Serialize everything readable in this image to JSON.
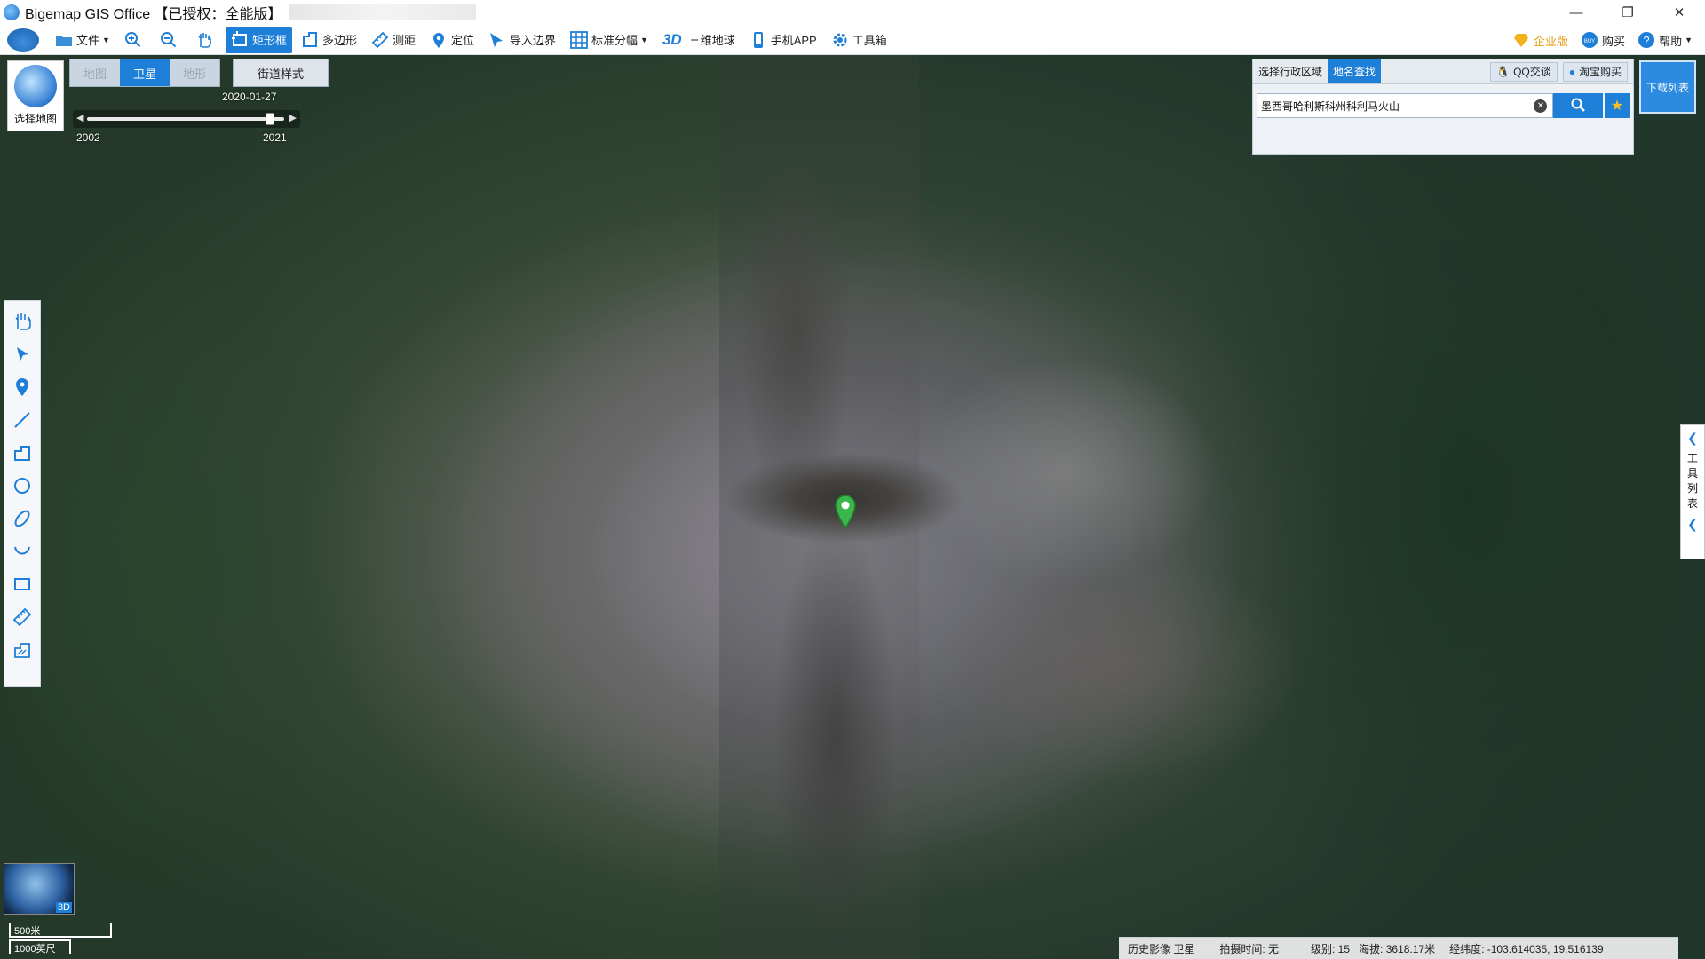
{
  "window": {
    "title": "Bigemap GIS Office 【已授权：全能版】",
    "controls": {
      "minimize": "—",
      "restore": "❐",
      "close": "✕"
    }
  },
  "toolbar": {
    "file": "文件",
    "rect_select": "矩形框",
    "polygon": "多边形",
    "measure": "测距",
    "locate": "定位",
    "import_boundary": "导入边界",
    "standard_sheet": "标准分幅",
    "three_d_label": "3D",
    "globe_3d": "三维地球",
    "mobile_app": "手机APP",
    "toolbox": "工具箱",
    "enterprise": "企业版",
    "buy": "购买",
    "help": "帮助"
  },
  "map_panel": {
    "select_map": "选择地图",
    "tabs": [
      "地图",
      "卫星",
      "地形"
    ],
    "active_tab": "卫星",
    "street_style": "街道样式",
    "timeline": {
      "current": "2020-01-27",
      "start": "2002",
      "end": "2021",
      "position": 0.93
    }
  },
  "search": {
    "tabs": [
      "选择行政区域",
      "地名查找"
    ],
    "active_tab": "地名查找",
    "qq_chat": "QQ交谈",
    "taobao_buy": "淘宝购买",
    "query": "墨西哥哈利斯科州科利马火山"
  },
  "download_list": "下载列表",
  "right_panel": {
    "label": "工具列表"
  },
  "mini_globe": {
    "label": "3D"
  },
  "scale": {
    "metric": "500米",
    "imperial": "1000英尺"
  },
  "status": {
    "history": "历史影像 卫星",
    "capture_time": "拍摄时间: 无",
    "level": "级别:  15",
    "altitude": "海拔: 3618.17米",
    "coordinates": "经纬度:  -103.614035, 19.516139"
  },
  "colors": {
    "accent": "#1e7fd8",
    "marker": "#3cb54a",
    "forest": "#1f3324",
    "ash": "#8f8d93"
  }
}
